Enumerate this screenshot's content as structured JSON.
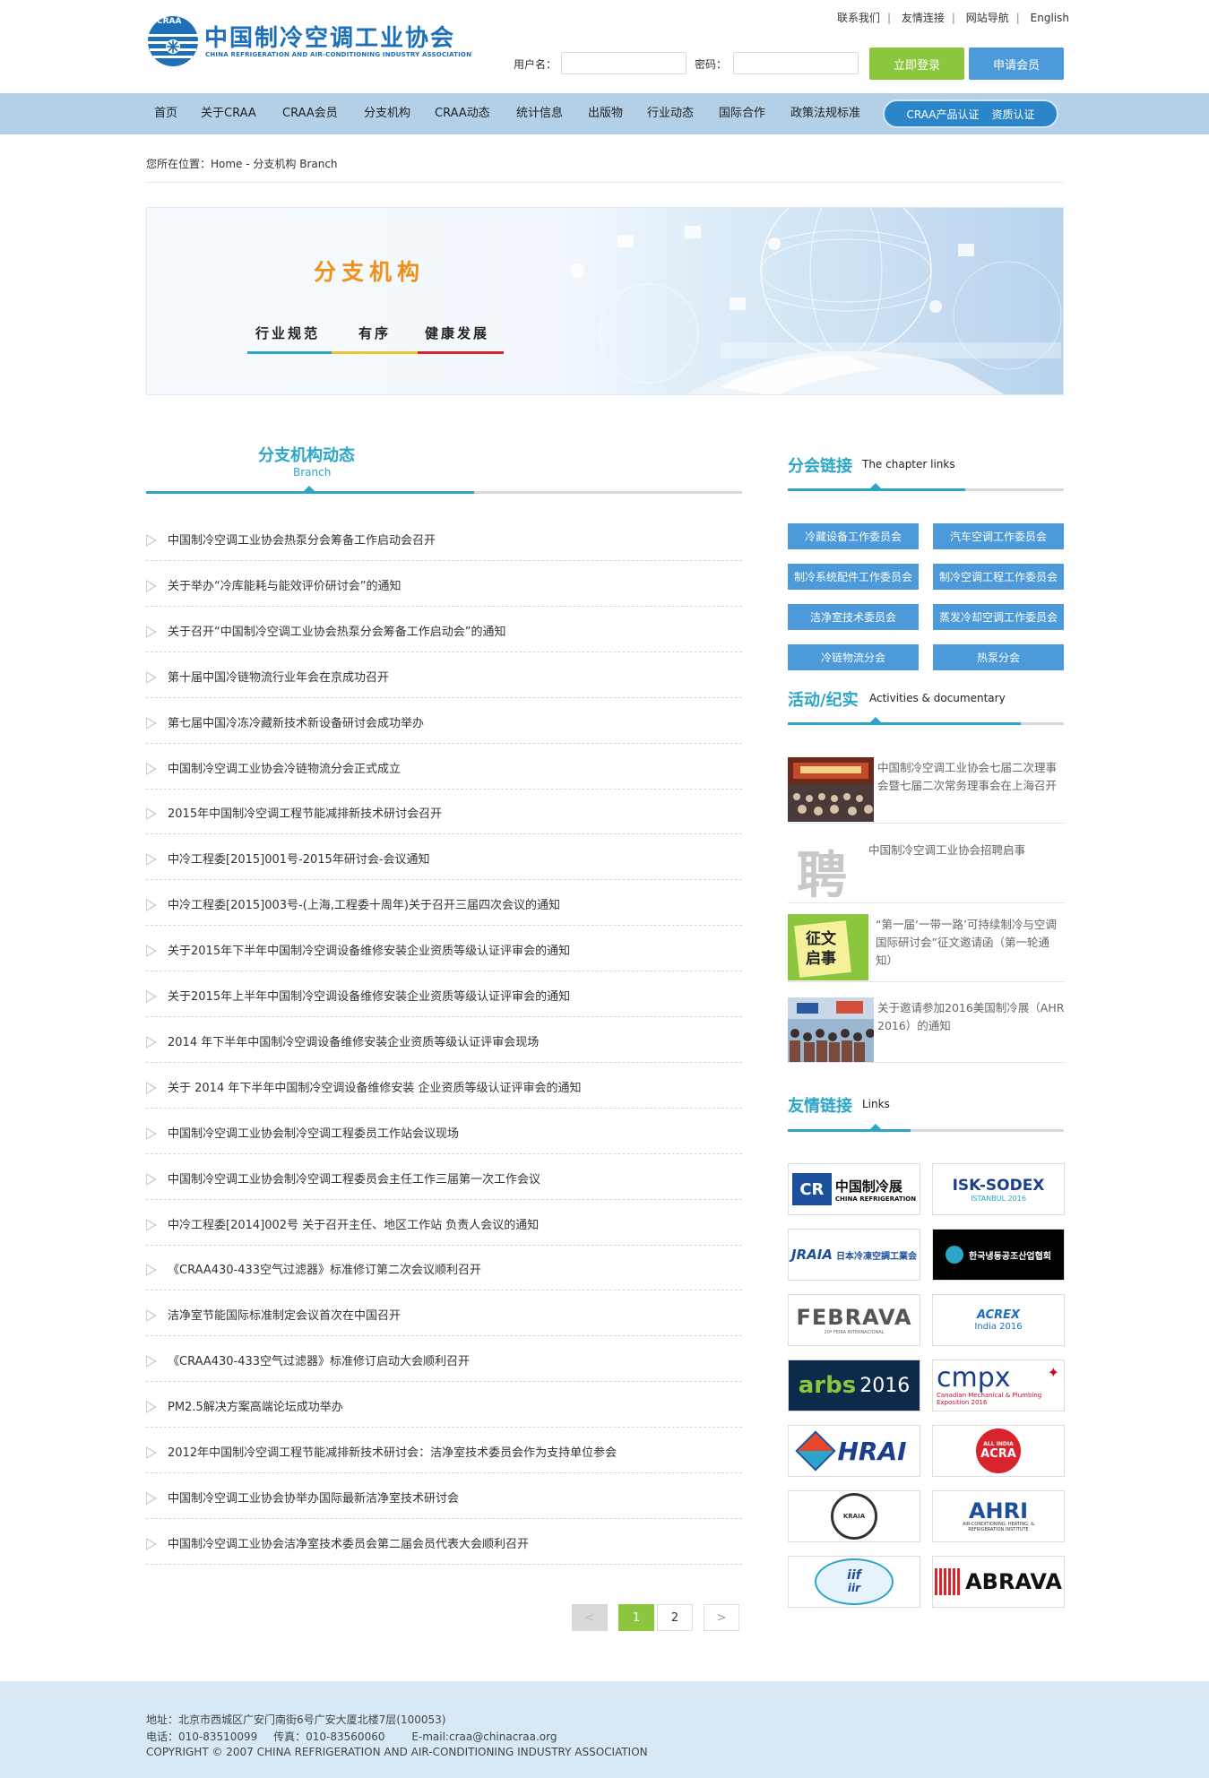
{
  "header": {
    "top_links": [
      "联系我们",
      "友情连接",
      "网站导航",
      "English"
    ],
    "logo_title": "中国制冷空调工业协会",
    "logo_subtitle": "CHINA REFRIGERATION AND AIR-CONDITIONING INDUSTRY ASSOCIATION",
    "logo_badge": "CRAA",
    "username_label": "用户名：",
    "password_label": "密码：",
    "username_value": "",
    "password_value": "",
    "login_button": "立即登录",
    "apply_button": "申请会员"
  },
  "nav": {
    "items": [
      "首页",
      "关于CRAA",
      "CRAA会员",
      "分支机构",
      "CRAA动态",
      "统计信息",
      "出版物",
      "行业动态",
      "国际合作",
      "政策法规标准"
    ],
    "pill": [
      "CRAA产品认证",
      "资质认证"
    ]
  },
  "breadcrumb": "您所在位置：Home - 分支机构 Branch",
  "banner": {
    "title": "分支机构",
    "slogans": [
      "行业规范",
      "有序",
      "健康发展"
    ]
  },
  "news": {
    "title": "分支机构动态",
    "title_en": "Branch",
    "items": [
      "中国制冷空调工业协会热泵分会筹备工作启动会召开",
      "关于举办“冷库能耗与能效评价研讨会”的通知",
      "关于召开“中国制冷空调工业协会热泵分会筹备工作启动会”的通知",
      "第十届中国冷链物流行业年会在京成功召开",
      "第七届中国冷冻冷藏新技术新设备研讨会成功举办",
      "中国制冷空调工业协会冷链物流分会正式成立",
      "2015年中国制冷空调工程节能减排新技术研讨会召开",
      "中冷工程委[2015]001号-2015年研讨会-会议通知",
      "中冷工程委[2015]003号-(上海,工程委十周年)关于召开三届四次会议的通知",
      "关于2015年下半年中国制冷空调设备维修安装企业资质等级认证评审会的通知",
      "关于2015年上半年中国制冷空调设备维修安装企业资质等级认证评审会的通知",
      "2014 年下半年中国制冷空调设备维修安装企业资质等级认证评审会现场",
      "关于 2014 年下半年中国制冷空调设备维修安装 企业资质等级认证评审会的通知",
      "中国制冷空调工业协会制冷空调工程委员工作站会议现场",
      "中国制冷空调工业协会制冷空调工程委员会主任工作三届第一次工作会议",
      "中冷工程委[2014]002号 关于召开主任、地区工作站 负责人会议的通知",
      "《CRAA430-433空气过滤器》标准修订第二次会议顺利召开",
      "洁净室节能国际标准制定会议首次在中国召开",
      "《CRAA430-433空气过滤器》标准修订启动大会顺利召开",
      "PM2.5解决方案高端论坛成功举办",
      "2012年中国制冷空调工程节能减排新技术研讨会：洁净室技术委员会作为支持单位参会",
      "中国制冷空调工业协会协举办国际最新洁净室技术研讨会",
      "中国制冷空调工业协会洁净室技术委员会第二届会员代表大会顺利召开"
    ]
  },
  "pager": {
    "prev": "<",
    "pages": [
      "1",
      "2"
    ],
    "current": "1",
    "next": ">"
  },
  "chapters": {
    "title": "分会链接",
    "title_en": "The chapter links",
    "items": [
      "冷藏设备工作委员会",
      "汽车空调工作委员会",
      "制冷系统配件工作委员会",
      "制冷空调工程工作委员会",
      "洁净室技术委员会",
      "蒸发冷却空调工作委员会",
      "冷链物流分会",
      "热泵分会"
    ]
  },
  "activities": {
    "title": "活动/纪实",
    "title_en": "Activities & documentary",
    "items": [
      {
        "text": "中国制冷空调工业协会七届二次理事会暨七届二次常务理事会在上海召开",
        "thumb": "meeting-photo"
      },
      {
        "text": "中国制冷空调工业协会招聘启事",
        "thumb": "聘"
      },
      {
        "text": "“第一届‘一带一路’可持续制冷与空调国际研讨会”征文邀请函（第一轮通知）",
        "thumb": "征文启事"
      },
      {
        "text": "关于邀请参加2016美国制冷展（AHR 2016）的通知",
        "thumb": "expo-photo"
      }
    ]
  },
  "links": {
    "title": "友情链接",
    "title_en": "Links",
    "logos": [
      {
        "name": "中国制冷展",
        "sub": "CHINA REFRIGERATION",
        "mark": "CR"
      },
      {
        "name": "ISK-SODEX",
        "sub": "ISTANBUL 2016"
      },
      {
        "name": "JRAIA",
        "sub": "日本冷凍空調工業会"
      },
      {
        "name": "한국냉동공조산업협회",
        "sub": ""
      },
      {
        "name": "FEBRAVA",
        "sub": "20ª FEIRA INTERNACIONAL"
      },
      {
        "name": "ACREX",
        "sub": "India 2016"
      },
      {
        "name": "arbs",
        "sub": "2016"
      },
      {
        "name": "cmpx",
        "sub": "Canadian Mechanical & Plumbing Exposition 2016"
      },
      {
        "name": "HRAI",
        "sub": ""
      },
      {
        "name": "ALL INDIA",
        "sub": "ACRA"
      },
      {
        "name": "KRAIA",
        "sub": ""
      },
      {
        "name": "AHRI",
        "sub": "AIR-CONDITIONING, HEATING, & REFRIGERATION INSTITUTE"
      },
      {
        "name": "iif",
        "sub": "iir"
      },
      {
        "name": "ABRAVA",
        "sub": ""
      }
    ]
  },
  "footer": {
    "address": "地址：北京市西城区广安门南街6号广安大厦北楼7层(100053)",
    "phone": "电话：010-83510099",
    "fax": "传真：010-83560060",
    "email": "E-mail:craa@chinacraa.org",
    "copyright": "COPYRIGHT © 2007 CHINA REFRIGERATION AND AIR-CONDITIONING INDUSTRY ASSOCIATION"
  },
  "colors": {
    "accent_teal": "#2ba6c9",
    "nav_bg": "#b3d0e7",
    "login_green": "#8cc63e",
    "apply_blue": "#4c9ad9",
    "banner_orange": "#f0901a",
    "footer_bg": "#d7e8f7"
  }
}
